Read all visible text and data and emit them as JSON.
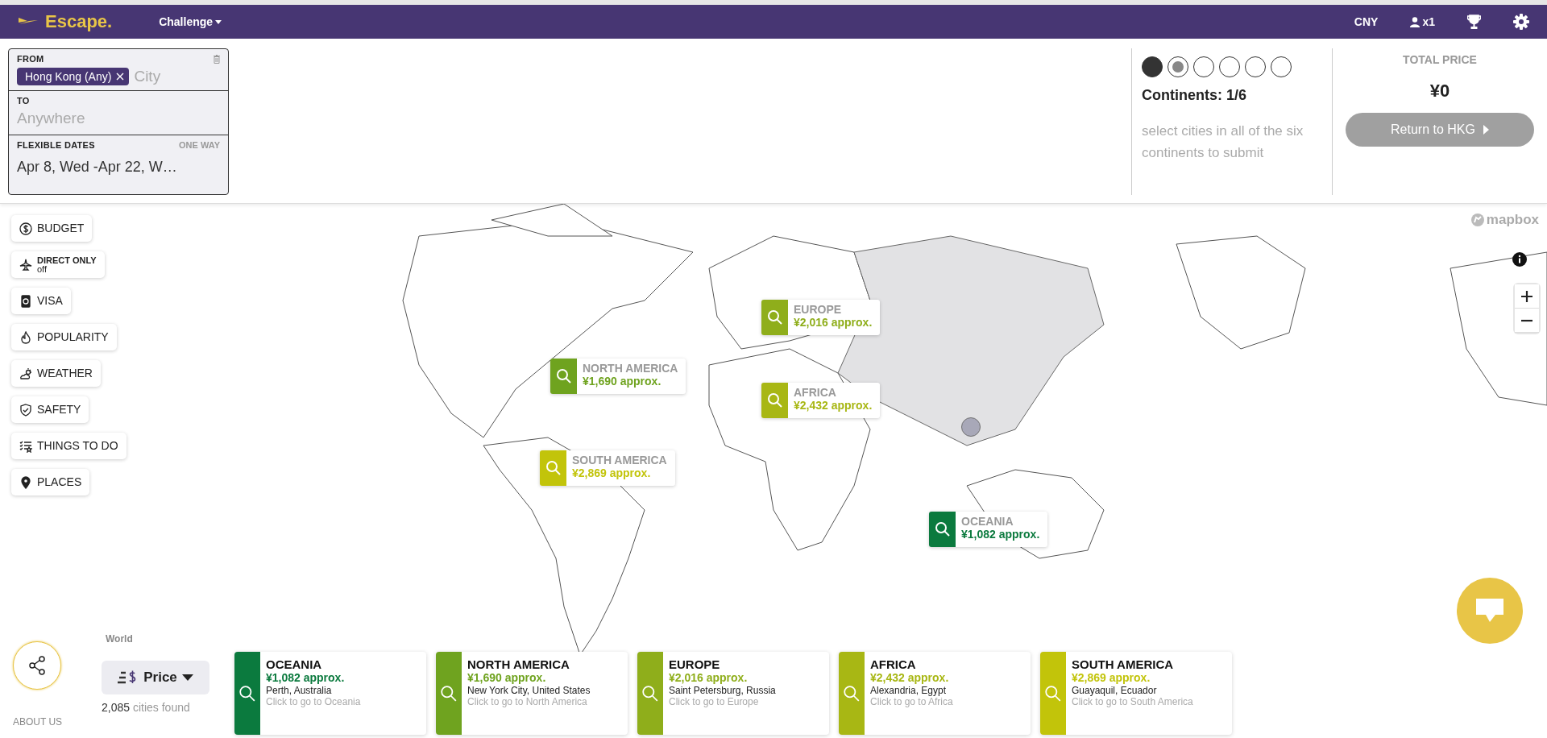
{
  "header": {
    "logo": "Escape.",
    "menu": "Challenge",
    "currency": "CNY",
    "travelers": "x1"
  },
  "search": {
    "from_label": "FROM",
    "from_tag": "Hong Kong (Any)",
    "from_placeholder": "City",
    "to_label": "TO",
    "to_placeholder": "Anywhere",
    "dates_label": "FLEXIBLE DATES",
    "trip_type": "ONE WAY",
    "dates_value": "Apr 8, Wed -Apr 22, W…"
  },
  "progress": {
    "steps": [
      {
        "kind": "done"
      },
      {
        "kind": "current"
      },
      {
        "kind": "empty"
      },
      {
        "kind": "empty"
      },
      {
        "kind": "empty"
      },
      {
        "kind": "empty"
      }
    ],
    "title": "Continents: 1/6",
    "hint": "select cities in all of the six continents to submit"
  },
  "total": {
    "label": "TOTAL PRICE",
    "value": "¥0",
    "button": "Return to HKG",
    "disabled": true
  },
  "filters": [
    {
      "label": "BUDGET"
    },
    {
      "label": "DIRECT ONLY",
      "status": "off"
    },
    {
      "label": "VISA"
    },
    {
      "label": "POPULARITY"
    },
    {
      "label": "WEATHER"
    },
    {
      "label": "SAFETY"
    },
    {
      "label": "THINGS TO DO"
    },
    {
      "label": "PLACES"
    }
  ],
  "map": {
    "attribution": "mapbox",
    "markers": [
      {
        "name": "EUROPE",
        "price": "¥2,016 approx.",
        "color": "#8fae1b"
      },
      {
        "name": "NORTH AMERICA",
        "price": "¥1,690 approx.",
        "color": "#6fa31f"
      },
      {
        "name": "AFRICA",
        "price": "¥2,432 approx.",
        "color": "#a8b714"
      },
      {
        "name": "SOUTH AMERICA",
        "price": "¥2,869 approx.",
        "color": "#c2c40a"
      },
      {
        "name": "OCEANIA",
        "price": "¥1,082 approx.",
        "color": "#0b7a3e"
      }
    ]
  },
  "bottom": {
    "region": "World",
    "sort": "Price",
    "count": "2,085",
    "count_label": "cities found",
    "about": "ABOUT US",
    "cards": [
      {
        "name": "OCEANIA",
        "price": "¥1,082 approx.",
        "city": "Perth, Australia",
        "hint": "Click to go to Oceania",
        "color": "#0b7a3e"
      },
      {
        "name": "NORTH AMERICA",
        "price": "¥1,690 approx.",
        "city": "New York City, United States",
        "hint": "Click to go to North America",
        "color": "#6fa31f"
      },
      {
        "name": "EUROPE",
        "price": "¥2,016 approx.",
        "city": "Saint Petersburg, Russia",
        "hint": "Click to go to Europe",
        "color": "#8fae1b"
      },
      {
        "name": "AFRICA",
        "price": "¥2,432 approx.",
        "city": "Alexandria, Egypt",
        "hint": "Click to go to Africa",
        "color": "#a8b714"
      },
      {
        "name": "SOUTH AMERICA",
        "price": "¥2,869 approx.",
        "city": "Guayaquil, Ecuador",
        "hint": "Click to go to South America",
        "color": "#c2c40a"
      }
    ]
  }
}
